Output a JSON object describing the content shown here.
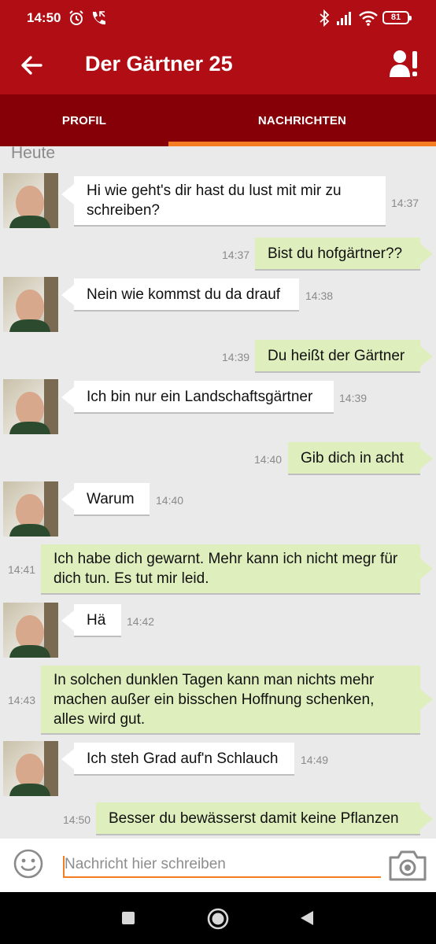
{
  "status_bar": {
    "time": "14:50",
    "battery": "81"
  },
  "app_bar": {
    "title": "Der Gärtner 25"
  },
  "tabs": [
    {
      "label": "PROFIL",
      "active": false
    },
    {
      "label": "NACHRICHTEN",
      "active": true
    }
  ],
  "colors": {
    "primary": "#b00d14",
    "tab_bar": "#860008",
    "accent": "#f57c20",
    "incoming_bubble": "#ffffff",
    "outgoing_bubble": "#dfeebd",
    "chat_background": "#eaeaea"
  },
  "chat": {
    "day_label": "Heute",
    "messages": [
      {
        "direction": "in",
        "text": "Hi wie geht's dir hast du lust mit mir zu schreiben?",
        "time": "14:37"
      },
      {
        "direction": "out",
        "text": "Bist du hofgärtner??",
        "time": "14:37"
      },
      {
        "direction": "in",
        "text": "Nein wie kommst du da drauf",
        "time": "14:38"
      },
      {
        "direction": "out",
        "text": "Du heißt der Gärtner",
        "time": "14:39"
      },
      {
        "direction": "in",
        "text": "Ich bin nur ein Landschaftsgärtner",
        "time": "14:39"
      },
      {
        "direction": "out",
        "text": "Gib dich in acht",
        "time": "14:40"
      },
      {
        "direction": "in",
        "text": "Warum",
        "time": "14:40"
      },
      {
        "direction": "out",
        "text": "Ich habe dich gewarnt. Mehr kann ich nicht megr für dich tun. Es tut mir leid.",
        "time": "14:41"
      },
      {
        "direction": "in",
        "text": "Hä",
        "time": "14:42"
      },
      {
        "direction": "out",
        "text": "In solchen dunklen Tagen kann man nichts mehr machen außer ein bisschen Hoffnung schenken, alles wird gut.",
        "time": "14:43"
      },
      {
        "direction": "in",
        "text": "Ich steh Grad auf'n Schlauch",
        "time": "14:49"
      },
      {
        "direction": "out",
        "text": "Besser du bewässerst damit keine Pflanzen",
        "time": "14:50"
      }
    ]
  },
  "composer": {
    "placeholder": "Nachricht hier schreiben",
    "value": ""
  },
  "icons": {
    "status": [
      "alarm-icon",
      "call-icon",
      "bluetooth-icon",
      "signal-icon",
      "wifi-icon",
      "battery-icon"
    ],
    "app_bar": [
      "back-arrow-icon",
      "report-user-icon"
    ],
    "composer": [
      "emoji-icon",
      "camera-icon"
    ],
    "navigation": [
      "recents-icon",
      "home-icon",
      "back-icon"
    ]
  }
}
